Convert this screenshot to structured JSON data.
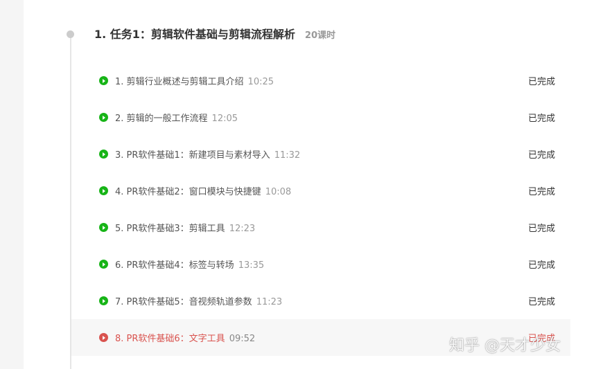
{
  "chapter": {
    "title": "1. 任务1：剪辑软件基础与剪辑流程解析",
    "count": "20课时"
  },
  "lessons": [
    {
      "title": "1. 剪辑行业概述与剪辑工具介绍",
      "duration": "10:25",
      "status": "已完成"
    },
    {
      "title": "2. 剪辑的一般工作流程",
      "duration": "12:05",
      "status": "已完成"
    },
    {
      "title": "3. PR软件基础1：新建项目与素材导入",
      "duration": "11:32",
      "status": "已完成"
    },
    {
      "title": "4. PR软件基础2：窗口模块与快捷键",
      "duration": "10:08",
      "status": "已完成"
    },
    {
      "title": "5. PR软件基础3：剪辑工具",
      "duration": "12:23",
      "status": "已完成"
    },
    {
      "title": "6. PR软件基础4：标签与转场",
      "duration": "13:35",
      "status": "已完成"
    },
    {
      "title": "7. PR软件基础5：音视频轨道参数",
      "duration": "11:23",
      "status": "已完成"
    },
    {
      "title": "8. PR软件基础6：文字工具",
      "duration": "09:52",
      "status": "已完成"
    }
  ],
  "watermark": "知乎 @天才少女",
  "colors": {
    "completed_icon": "#17b417",
    "active_accent": "#d9534f",
    "active_row_bg": "#f7f7f7"
  }
}
